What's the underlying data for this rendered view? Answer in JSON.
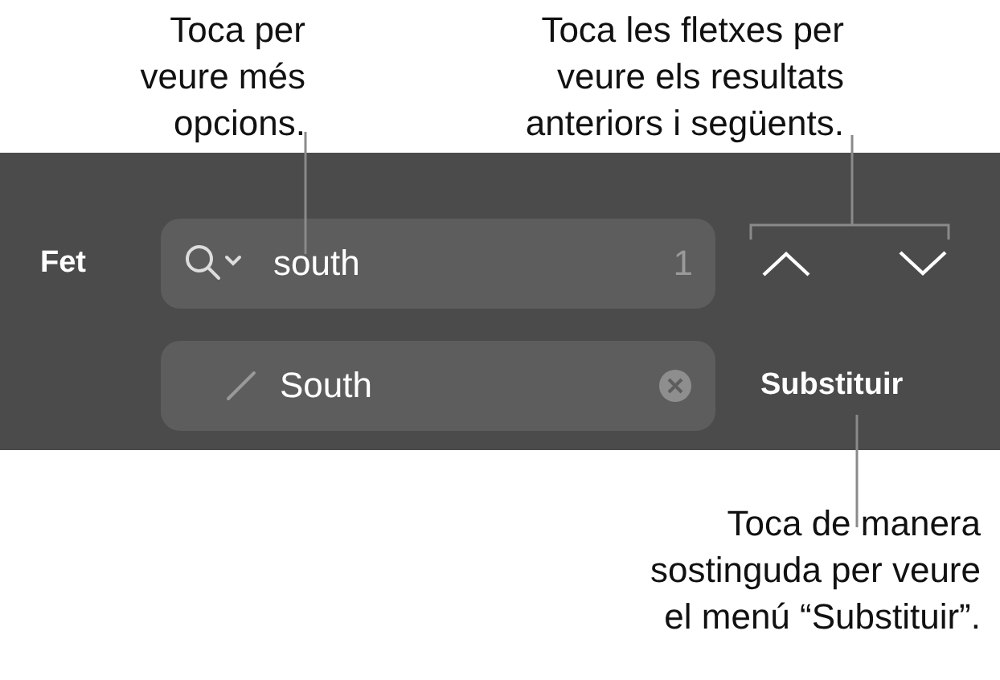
{
  "callouts_top": [
    {
      "lines": [
        "Toca per",
        "veure més",
        "opcions."
      ]
    },
    {
      "lines": [
        "Toca les fletxes per",
        "veure els resultats",
        "anteriors i següents."
      ]
    }
  ],
  "find_bar": {
    "done_button": "Fet",
    "search_field": {
      "value": "south",
      "match_count": "1"
    },
    "replace_field": {
      "value": "South"
    },
    "replace_button": "Substituir"
  },
  "callout_bottom": {
    "lines": [
      "Toca de manera",
      "sostinguda per veure",
      "el menú “Substituir”."
    ]
  }
}
